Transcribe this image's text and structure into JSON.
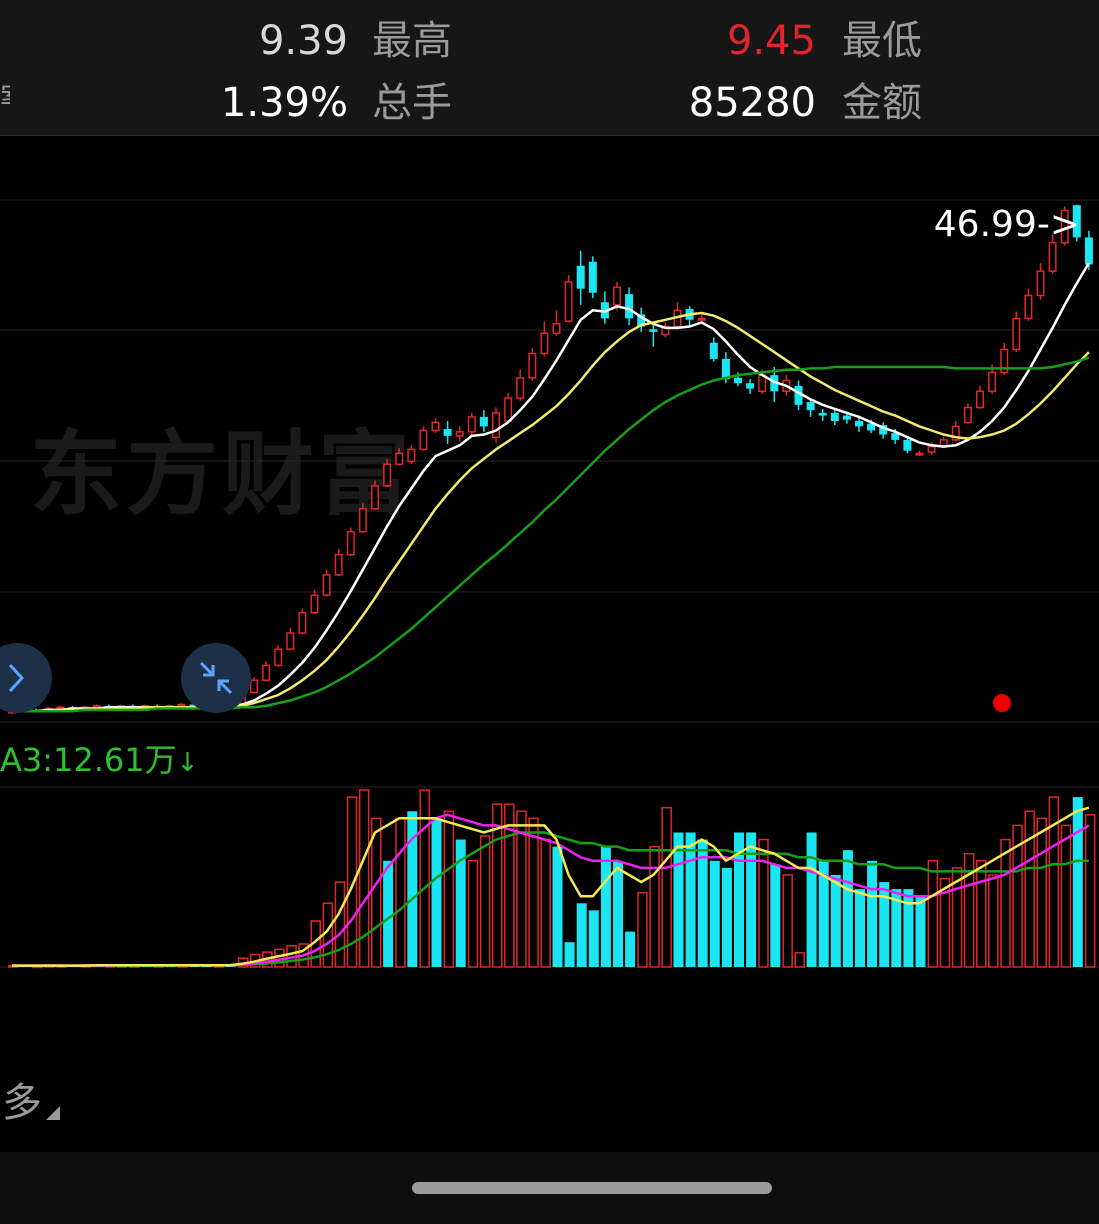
{
  "header": {
    "open_value": "9.39",
    "high_label": "最高",
    "low_value": "9.45",
    "low_label": "最低",
    "turnover_value": "1.39%",
    "volume_label": "总手",
    "amount_value": "85280",
    "amount_label": "金额",
    "left_clipped": "案"
  },
  "colors": {
    "up": "#e0262b",
    "down": "#19e6f2",
    "ma_fast": "#ffffff",
    "ma_mid": "#f2ea6e",
    "ma_slow": "#17a017",
    "vol_ma_1": "#f2ea4e",
    "vol_ma_2": "#ee22ee",
    "vol_ma_3": "#17a017",
    "grid": "#262626",
    "red_dot": "#ee0000"
  },
  "watermark": "东方财富",
  "max_price_label": "46.99->",
  "volume_indicator": {
    "label": "A3:12.61万",
    "arrow": "↓"
  },
  "more_label": "多",
  "icons": {
    "expand": "chevron-right-icon",
    "collapse": "compress-arrows-icon"
  },
  "chart_data": [
    {
      "type": "candlestick",
      "title": "",
      "max_label": "46.99",
      "candles_open_close_high_low": [
        [
          9.4,
          9.5,
          9.6,
          9.3
        ],
        [
          9.5,
          9.6,
          9.7,
          9.4
        ],
        [
          9.6,
          9.5,
          9.7,
          9.4
        ],
        [
          9.5,
          9.7,
          9.8,
          9.4
        ],
        [
          9.7,
          9.8,
          9.9,
          9.6
        ],
        [
          9.8,
          9.7,
          9.9,
          9.6
        ],
        [
          9.7,
          9.8,
          9.9,
          9.6
        ],
        [
          9.8,
          9.9,
          10.0,
          9.7
        ],
        [
          9.9,
          9.8,
          10.0,
          9.7
        ],
        [
          9.8,
          9.9,
          10.0,
          9.7
        ],
        [
          9.9,
          9.8,
          10.0,
          9.7
        ],
        [
          9.8,
          9.9,
          10.0,
          9.7
        ],
        [
          9.9,
          9.8,
          10.0,
          9.7
        ],
        [
          9.8,
          9.9,
          10.0,
          9.7
        ],
        [
          9.9,
          10.0,
          10.1,
          9.8
        ],
        [
          10.0,
          9.9,
          10.1,
          9.8
        ],
        [
          9.9,
          10.0,
          10.1,
          9.8
        ],
        [
          10.0,
          9.9,
          10.1,
          9.8
        ],
        [
          9.9,
          10.0,
          10.1,
          9.8
        ],
        [
          10.0,
          10.9,
          11.0,
          9.9
        ],
        [
          10.9,
          11.8,
          12.0,
          10.8
        ],
        [
          11.8,
          12.9,
          13.2,
          11.7
        ],
        [
          12.9,
          14.1,
          14.4,
          12.8
        ],
        [
          14.1,
          15.3,
          15.7,
          14.0
        ],
        [
          15.3,
          16.8,
          17.1,
          15.2
        ],
        [
          16.8,
          18.1,
          18.5,
          16.7
        ],
        [
          18.1,
          19.6,
          20.0,
          18.0
        ],
        [
          19.6,
          21.1,
          21.5,
          19.5
        ],
        [
          21.1,
          22.8,
          23.1,
          21.0
        ],
        [
          22.8,
          24.5,
          24.9,
          22.7
        ],
        [
          24.5,
          26.2,
          26.6,
          24.4
        ],
        [
          26.2,
          27.8,
          28.2,
          26.1
        ],
        [
          27.8,
          28.6,
          29.0,
          27.7
        ],
        [
          28.0,
          28.9,
          29.2,
          27.8
        ],
        [
          28.9,
          30.3,
          30.6,
          28.8
        ],
        [
          30.3,
          30.9,
          31.2,
          30.1
        ],
        [
          30.4,
          29.9,
          31.0,
          29.3
        ],
        [
          29.9,
          30.2,
          30.6,
          29.5
        ],
        [
          30.2,
          31.3,
          31.6,
          30.0
        ],
        [
          31.3,
          30.6,
          31.8,
          30.2
        ],
        [
          29.8,
          31.6,
          32.0,
          29.4
        ],
        [
          31.0,
          32.7,
          33.1,
          30.8
        ],
        [
          32.7,
          34.2,
          34.8,
          32.5
        ],
        [
          34.2,
          36.0,
          36.4,
          34.0
        ],
        [
          36.0,
          37.5,
          38.4,
          35.8
        ],
        [
          37.5,
          38.2,
          39.2,
          37.3
        ],
        [
          38.4,
          41.3,
          41.8,
          38.3
        ],
        [
          42.5,
          40.8,
          43.6,
          39.6
        ],
        [
          42.8,
          40.5,
          43.2,
          40.1
        ],
        [
          39.8,
          38.6,
          40.6,
          38.2
        ],
        [
          39.6,
          40.9,
          41.3,
          39.2
        ],
        [
          40.4,
          38.6,
          40.9,
          38.1
        ],
        [
          38.9,
          38.0,
          39.4,
          37.6
        ],
        [
          37.8,
          37.6,
          38.2,
          36.5
        ],
        [
          37.4,
          38.0,
          38.3,
          37.2
        ],
        [
          38.0,
          39.2,
          39.8,
          37.8
        ],
        [
          39.3,
          38.5,
          39.5,
          38.0
        ],
        [
          38.5,
          38.6,
          38.9,
          38.2
        ],
        [
          36.8,
          35.6,
          37.2,
          35.4
        ],
        [
          35.6,
          34.1,
          36.1,
          33.8
        ],
        [
          34.2,
          33.8,
          34.6,
          33.6
        ],
        [
          33.8,
          33.4,
          34.1,
          33.0
        ],
        [
          33.2,
          34.4,
          34.8,
          33.0
        ],
        [
          34.4,
          33.2,
          35.0,
          32.4
        ],
        [
          33.2,
          34.0,
          34.4,
          32.9
        ],
        [
          33.6,
          32.2,
          34.0,
          31.8
        ],
        [
          32.4,
          31.8,
          32.6,
          31.3
        ],
        [
          31.6,
          31.4,
          31.9,
          31.0
        ],
        [
          31.6,
          31.0,
          31.8,
          30.7
        ],
        [
          31.4,
          31.1,
          31.7,
          30.8
        ],
        [
          31.0,
          30.6,
          31.4,
          30.2
        ],
        [
          30.8,
          30.3,
          31.1,
          30.1
        ],
        [
          30.7,
          30.0,
          30.9,
          29.7
        ],
        [
          30.1,
          29.6,
          30.4,
          29.3
        ],
        [
          29.6,
          28.8,
          29.9,
          28.6
        ],
        [
          28.6,
          28.6,
          28.8,
          28.4
        ],
        [
          28.7,
          29.1,
          29.4,
          28.5
        ],
        [
          29.1,
          29.6,
          29.8,
          29.0
        ],
        [
          29.6,
          30.6,
          31.0,
          29.5
        ],
        [
          30.9,
          32.0,
          32.3,
          30.8
        ],
        [
          32.0,
          33.2,
          33.6,
          31.9
        ],
        [
          33.2,
          34.6,
          35.2,
          33.0
        ],
        [
          34.6,
          36.3,
          36.8,
          34.4
        ],
        [
          36.3,
          38.6,
          39.1,
          36.1
        ],
        [
          38.6,
          40.3,
          40.8,
          38.4
        ],
        [
          40.3,
          42.1,
          42.7,
          40.0
        ],
        [
          42.1,
          44.2,
          44.8,
          41.9
        ],
        [
          44.2,
          46.6,
          46.9,
          44.0
        ],
        [
          46.99,
          44.6,
          46.99,
          44.3
        ],
        [
          44.6,
          42.6,
          45.1,
          42.2
        ]
      ],
      "ma_fast": [
        9.5,
        9.5,
        9.5,
        9.6,
        9.6,
        9.7,
        9.7,
        9.7,
        9.8,
        9.8,
        9.8,
        9.8,
        9.8,
        9.8,
        9.8,
        9.8,
        9.9,
        9.9,
        9.9,
        10.0,
        10.3,
        10.8,
        11.4,
        12.2,
        13.1,
        14.2,
        15.5,
        16.9,
        18.4,
        20.0,
        21.6,
        23.2,
        24.7,
        26.0,
        27.3,
        28.4,
        28.8,
        29.2,
        29.9,
        30.0,
        30.3,
        30.9,
        31.8,
        32.8,
        34.1,
        35.5,
        37.0,
        38.5,
        39.2,
        39.1,
        39.5,
        39.3,
        38.7,
        38.2,
        37.9,
        37.9,
        38.0,
        38.3,
        37.8,
        36.9,
        35.9,
        35.0,
        34.4,
        33.9,
        33.6,
        33.1,
        32.6,
        32.2,
        31.9,
        31.6,
        31.3,
        30.9,
        30.5,
        30.2,
        29.8,
        29.4,
        29.2,
        29.1,
        29.2,
        29.6,
        30.2,
        31.0,
        32.0,
        33.3,
        34.7,
        36.3,
        37.9,
        39.6,
        41.2,
        42.7
      ],
      "ma_mid": [
        9.5,
        9.5,
        9.5,
        9.5,
        9.6,
        9.6,
        9.6,
        9.7,
        9.7,
        9.7,
        9.7,
        9.8,
        9.8,
        9.8,
        9.8,
        9.8,
        9.8,
        9.8,
        9.9,
        9.9,
        10.1,
        10.4,
        10.7,
        11.2,
        11.8,
        12.5,
        13.3,
        14.3,
        15.4,
        16.6,
        17.9,
        19.3,
        20.6,
        21.9,
        23.2,
        24.5,
        25.6,
        26.6,
        27.5,
        28.2,
        28.9,
        29.5,
        30.1,
        30.7,
        31.4,
        32.1,
        33.0,
        34.0,
        35.1,
        36.1,
        36.9,
        37.6,
        38.1,
        38.3,
        38.5,
        38.7,
        38.9,
        39.0,
        38.8,
        38.4,
        37.9,
        37.3,
        36.7,
        36.1,
        35.5,
        34.9,
        34.3,
        33.8,
        33.3,
        32.9,
        32.5,
        32.1,
        31.7,
        31.4,
        31.0,
        30.6,
        30.3,
        30.0,
        29.8,
        29.7,
        29.8,
        30.0,
        30.3,
        30.8,
        31.5,
        32.3,
        33.2,
        34.2,
        35.2,
        36.1
      ],
      "ma_slow": [
        9.5,
        9.5,
        9.5,
        9.5,
        9.5,
        9.5,
        9.6,
        9.6,
        9.6,
        9.6,
        9.6,
        9.6,
        9.7,
        9.7,
        9.7,
        9.7,
        9.7,
        9.7,
        9.7,
        9.8,
        9.8,
        9.9,
        10.1,
        10.3,
        10.6,
        10.9,
        11.3,
        11.8,
        12.3,
        12.9,
        13.5,
        14.2,
        14.9,
        15.6,
        16.4,
        17.2,
        18.0,
        18.8,
        19.6,
        20.4,
        21.1,
        21.9,
        22.7,
        23.5,
        24.4,
        25.2,
        26.1,
        27.0,
        27.9,
        28.8,
        29.6,
        30.4,
        31.1,
        31.8,
        32.4,
        32.9,
        33.3,
        33.7,
        34.0,
        34.2,
        34.4,
        34.5,
        34.6,
        34.7,
        34.8,
        34.8,
        34.9,
        34.9,
        35.0,
        35.0,
        35.0,
        35.0,
        35.0,
        35.0,
        35.0,
        35.0,
        35.0,
        35.0,
        34.9,
        34.9,
        34.9,
        34.9,
        34.9,
        34.9,
        34.9,
        34.9,
        35.0,
        35.2,
        35.4,
        35.7
      ]
    },
    {
      "type": "bar",
      "title": "",
      "label": "A3:12.61万",
      "ylim": [
        0,
        50
      ],
      "volumes": [
        0.4,
        0.5,
        0.3,
        0.6,
        0.4,
        0.5,
        0.6,
        0.4,
        0.5,
        0.3,
        0.4,
        0.5,
        0.6,
        0.4,
        0.5,
        0.6,
        0.4,
        0.5,
        0.6,
        2.5,
        3.5,
        4.2,
        5.0,
        6.0,
        6.5,
        13.0,
        18.0,
        24.0,
        48.0,
        50.0,
        42.0,
        30.0,
        42.0,
        44.0,
        50.0,
        42.0,
        44.0,
        36.0,
        30.0,
        37.0,
        46.0,
        46.0,
        44.0,
        42.0,
        36.0,
        34.0,
        7.0,
        18.0,
        16.0,
        34.0,
        30.0,
        10.0,
        21.0,
        34.0,
        45.0,
        38.0,
        38.0,
        36.0,
        30.0,
        28.0,
        38.0,
        38.0,
        36.0,
        29.0,
        26.0,
        4.0,
        38.0,
        30.0,
        26.0,
        33.0,
        22.0,
        30.0,
        24.0,
        22.0,
        22.0,
        20.0,
        30.0,
        25.0,
        28.0,
        32.0,
        30.0,
        26.0,
        36.0,
        40.0,
        44.0,
        42.0,
        48.0,
        40.0,
        48.0,
        43.0
      ],
      "up_flags": [
        1,
        0,
        1,
        1,
        1,
        0,
        1,
        0,
        1,
        0,
        1,
        0,
        1,
        0,
        1,
        0,
        0,
        1,
        0,
        1,
        1,
        1,
        1,
        1,
        1,
        1,
        1,
        1,
        1,
        1,
        1,
        0,
        1,
        0,
        1,
        0,
        1,
        0,
        1,
        1,
        1,
        1,
        1,
        1,
        1,
        0,
        0,
        0,
        0,
        0,
        0,
        0,
        1,
        1,
        1,
        0,
        0,
        0,
        0,
        0,
        0,
        0,
        1,
        0,
        1,
        1,
        0,
        0,
        0,
        0,
        0,
        0,
        0,
        0,
        0,
        0,
        1,
        1,
        1,
        1,
        1,
        1,
        1,
        1,
        1,
        1,
        1,
        1,
        0,
        1
      ],
      "vol_ma_1": [
        0.4,
        0.4,
        0.4,
        0.4,
        0.4,
        0.4,
        0.4,
        0.5,
        0.5,
        0.5,
        0.5,
        0.5,
        0.5,
        0.5,
        0.5,
        0.5,
        0.5,
        0.5,
        0.5,
        0.9,
        1.5,
        2.3,
        3.0,
        3.7,
        4.5,
        7.0,
        10.0,
        15.0,
        22.0,
        30.0,
        38.0,
        40.0,
        42.0,
        42.0,
        42.0,
        42.0,
        41.0,
        40.0,
        39.0,
        38.0,
        39.0,
        40.0,
        40.0,
        40.0,
        40.0,
        36.0,
        26.0,
        20.0,
        20.0,
        24.0,
        28.0,
        26.0,
        24.0,
        26.0,
        30.0,
        34.0,
        34.0,
        36.0,
        34.0,
        30.0,
        32.0,
        34.0,
        33.0,
        32.0,
        30.0,
        28.0,
        28.0,
        26.0,
        24.0,
        22.0,
        21.0,
        20.0,
        20.0,
        19.0,
        18.0,
        18.0,
        20.0,
        22.0,
        24.0,
        26.0,
        28.0,
        30.0,
        32.0,
        34.0,
        36.0,
        38.0,
        40.0,
        42.0,
        44.0,
        45.0
      ],
      "vol_ma_2": [
        0.4,
        0.4,
        0.4,
        0.4,
        0.4,
        0.4,
        0.4,
        0.4,
        0.4,
        0.5,
        0.5,
        0.5,
        0.5,
        0.5,
        0.5,
        0.5,
        0.5,
        0.5,
        0.5,
        0.7,
        1.0,
        1.5,
        2.0,
        2.6,
        3.2,
        4.5,
        6.5,
        9.0,
        13.0,
        18.0,
        23.0,
        28.0,
        32.0,
        36.0,
        39.0,
        42.0,
        43.0,
        42.0,
        41.0,
        40.0,
        40.0,
        39.0,
        38.0,
        37.0,
        36.0,
        35.0,
        33.0,
        31.0,
        30.0,
        30.0,
        30.0,
        29.0,
        28.0,
        28.0,
        28.0,
        29.0,
        30.0,
        31.0,
        31.0,
        31.0,
        30.0,
        30.0,
        30.0,
        29.0,
        28.0,
        28.0,
        27.0,
        26.0,
        25.0,
        24.0,
        23.0,
        22.0,
        22.0,
        21.0,
        20.0,
        20.0,
        20.0,
        21.0,
        22.0,
        23.0,
        24.0,
        25.0,
        26.0,
        28.0,
        30.0,
        32.0,
        34.0,
        36.0,
        38.0,
        40.0
      ],
      "vol_ma_3": [
        0.4,
        0.4,
        0.4,
        0.4,
        0.4,
        0.4,
        0.4,
        0.4,
        0.4,
        0.4,
        0.4,
        0.4,
        0.4,
        0.4,
        0.5,
        0.5,
        0.5,
        0.5,
        0.5,
        0.6,
        0.8,
        1.0,
        1.3,
        1.7,
        2.1,
        2.7,
        3.6,
        4.8,
        6.5,
        8.5,
        11.0,
        13.5,
        16.0,
        19.0,
        22.0,
        25.0,
        27.5,
        30.0,
        32.0,
        34.0,
        36.0,
        37.0,
        38.0,
        38.0,
        38.0,
        37.0,
        36.0,
        35.0,
        35.0,
        34.0,
        34.0,
        33.0,
        33.0,
        33.0,
        33.0,
        33.0,
        33.0,
        33.0,
        33.0,
        33.0,
        32.0,
        32.0,
        32.0,
        32.0,
        32.0,
        31.0,
        31.0,
        30.0,
        30.0,
        30.0,
        29.0,
        29.0,
        29.0,
        28.0,
        28.0,
        28.0,
        27.0,
        27.0,
        27.0,
        27.0,
        27.0,
        27.0,
        27.0,
        27.0,
        28.0,
        28.0,
        29.0,
        29.0,
        30.0,
        30.0
      ]
    }
  ]
}
